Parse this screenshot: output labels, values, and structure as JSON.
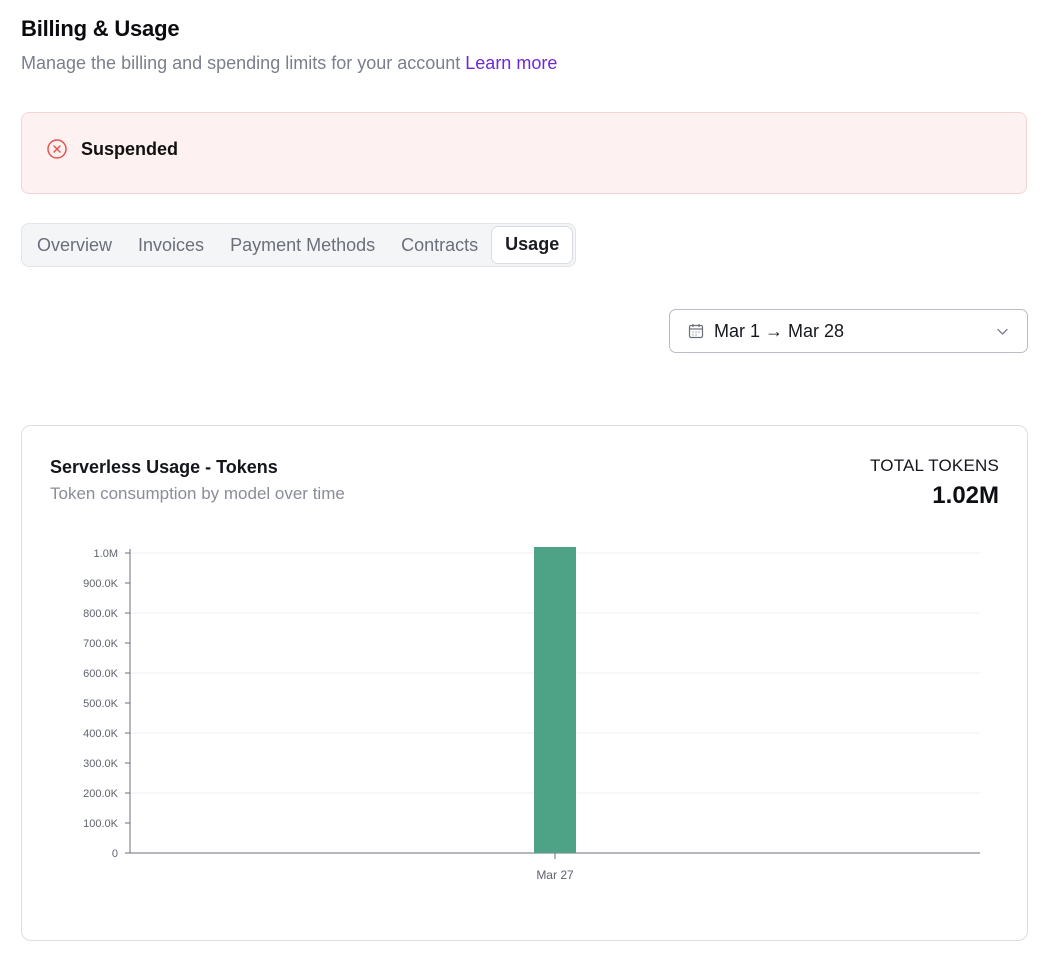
{
  "header": {
    "title": "Billing & Usage",
    "subtitle": "Manage the billing and spending limits for your account",
    "learn_more": "Learn more"
  },
  "alert": {
    "icon": "x-circle-icon",
    "text": "Suspended",
    "color": "#e5534b"
  },
  "tabs": [
    {
      "label": "Overview",
      "active": false
    },
    {
      "label": "Invoices",
      "active": false
    },
    {
      "label": "Payment Methods",
      "active": false
    },
    {
      "label": "Contracts",
      "active": false
    },
    {
      "label": "Usage",
      "active": true
    }
  ],
  "date_range": {
    "icon": "calendar-icon",
    "label": "Mar 1 → Mar 28",
    "chevron": "chevron-down-icon"
  },
  "usage_card": {
    "title": "Serverless Usage - Tokens",
    "subtitle": "Token consumption by model over time",
    "total_label": "TOTAL TOKENS",
    "total_value": "1.02M"
  },
  "chart_data": {
    "type": "bar",
    "categories": [
      "Mar 27"
    ],
    "values": [
      1020000
    ],
    "ylim": [
      0,
      1000000
    ],
    "yticks": [
      0,
      100000,
      200000,
      300000,
      400000,
      500000,
      600000,
      700000,
      800000,
      900000,
      1000000
    ],
    "ytick_labels": [
      "0",
      "100.0K",
      "200.0K",
      "300.0K",
      "400.0K",
      "500.0K",
      "600.0K",
      "700.0K",
      "800.0K",
      "900.0K",
      "1.0M"
    ],
    "grid": true,
    "bar_color": "#4ea386",
    "xlabel": "",
    "ylabel": ""
  }
}
